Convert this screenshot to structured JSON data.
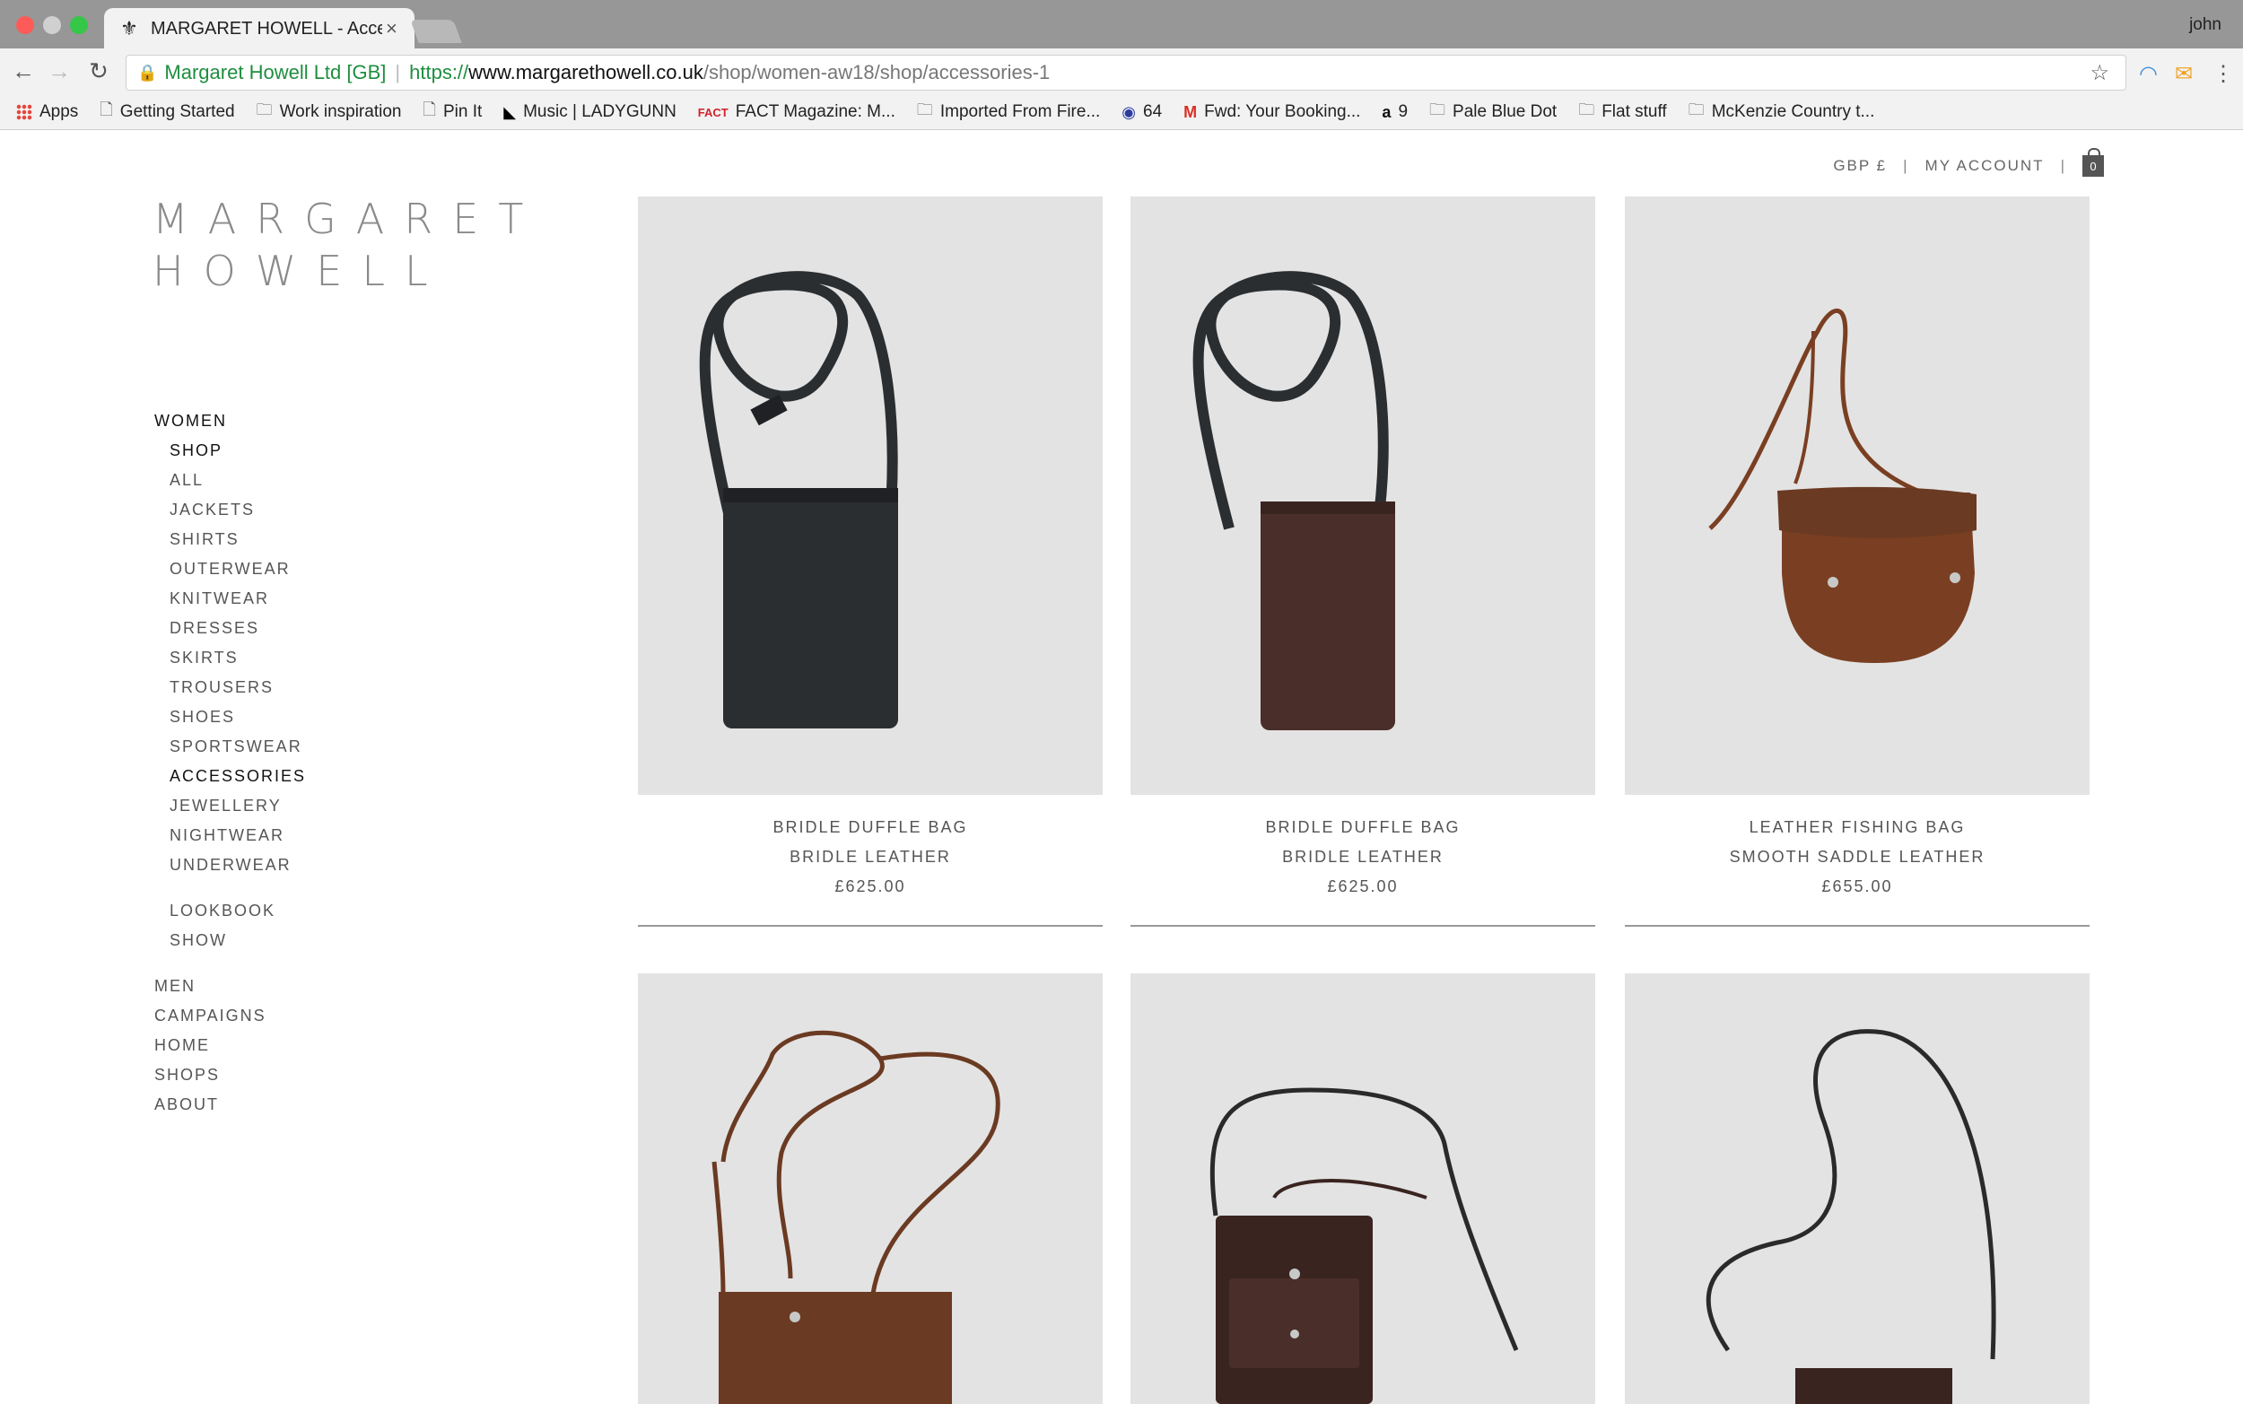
{
  "browser": {
    "tab_title": "MARGARET HOWELL - Accessories",
    "profile_name": "john",
    "address": {
      "ev_label": "Margaret Howell Ltd [GB]",
      "scheme": "https://",
      "host": "www.margarethowell.co.uk",
      "path": "/shop/women-aw18/shop/accessories-1"
    },
    "bookmarks": [
      {
        "label": "Apps",
        "icon": "apps-grid-icon"
      },
      {
        "label": "Getting Started",
        "icon": "page-icon"
      },
      {
        "label": "Work inspiration",
        "icon": "folder-icon"
      },
      {
        "label": "Pin It",
        "icon": "page-icon"
      },
      {
        "label": "Music | LADYGUNN",
        "icon": "ladygunn-icon"
      },
      {
        "label": "FACT Magazine: M...",
        "icon": "fact-icon"
      },
      {
        "label": "Imported From Fire...",
        "icon": "folder-icon"
      },
      {
        "label": "64",
        "icon": "circle-logo-icon"
      },
      {
        "label": "Fwd: Your Booking...",
        "icon": "gmail-icon"
      },
      {
        "label": "9",
        "icon": "amazon-icon"
      },
      {
        "label": "Pale Blue Dot",
        "icon": "folder-icon"
      },
      {
        "label": "Flat stuff",
        "icon": "folder-icon"
      },
      {
        "label": "McKenzie Country t...",
        "icon": "folder-icon"
      }
    ]
  },
  "site": {
    "logo_line1": "MARGARET",
    "logo_line2": "HOWELL",
    "currency": "GBP £",
    "account": "MY ACCOUNT",
    "bag_count": "0"
  },
  "nav": {
    "women": "WOMEN",
    "shop": "SHOP",
    "categories": [
      "ALL",
      "JACKETS",
      "SHIRTS",
      "OUTERWEAR",
      "KNITWEAR",
      "DRESSES",
      "SKIRTS",
      "TROUSERS",
      "SHOES",
      "SPORTSWEAR",
      "ACCESSORIES",
      "JEWELLERY",
      "NIGHTWEAR",
      "UNDERWEAR"
    ],
    "extras": [
      "LOOKBOOK",
      "SHOW"
    ],
    "main": [
      "MEN",
      "CAMPAIGNS",
      "HOME",
      "SHOPS",
      "ABOUT"
    ]
  },
  "products": [
    {
      "name": "BRIDLE DUFFLE BAG",
      "material": "BRIDLE LEATHER",
      "price": "£625.00",
      "color": "#2b2e31"
    },
    {
      "name": "BRIDLE DUFFLE BAG",
      "material": "BRIDLE LEATHER",
      "price": "£625.00",
      "color": "#4a2e29"
    },
    {
      "name": "LEATHER FISHING BAG",
      "material": "SMOOTH SADDLE LEATHER",
      "price": "£655.00",
      "color": "#7a3f22"
    },
    {
      "color": "#6b3a22"
    },
    {
      "color": "#3a2420"
    },
    {
      "color": "#2a2a2a"
    }
  ]
}
